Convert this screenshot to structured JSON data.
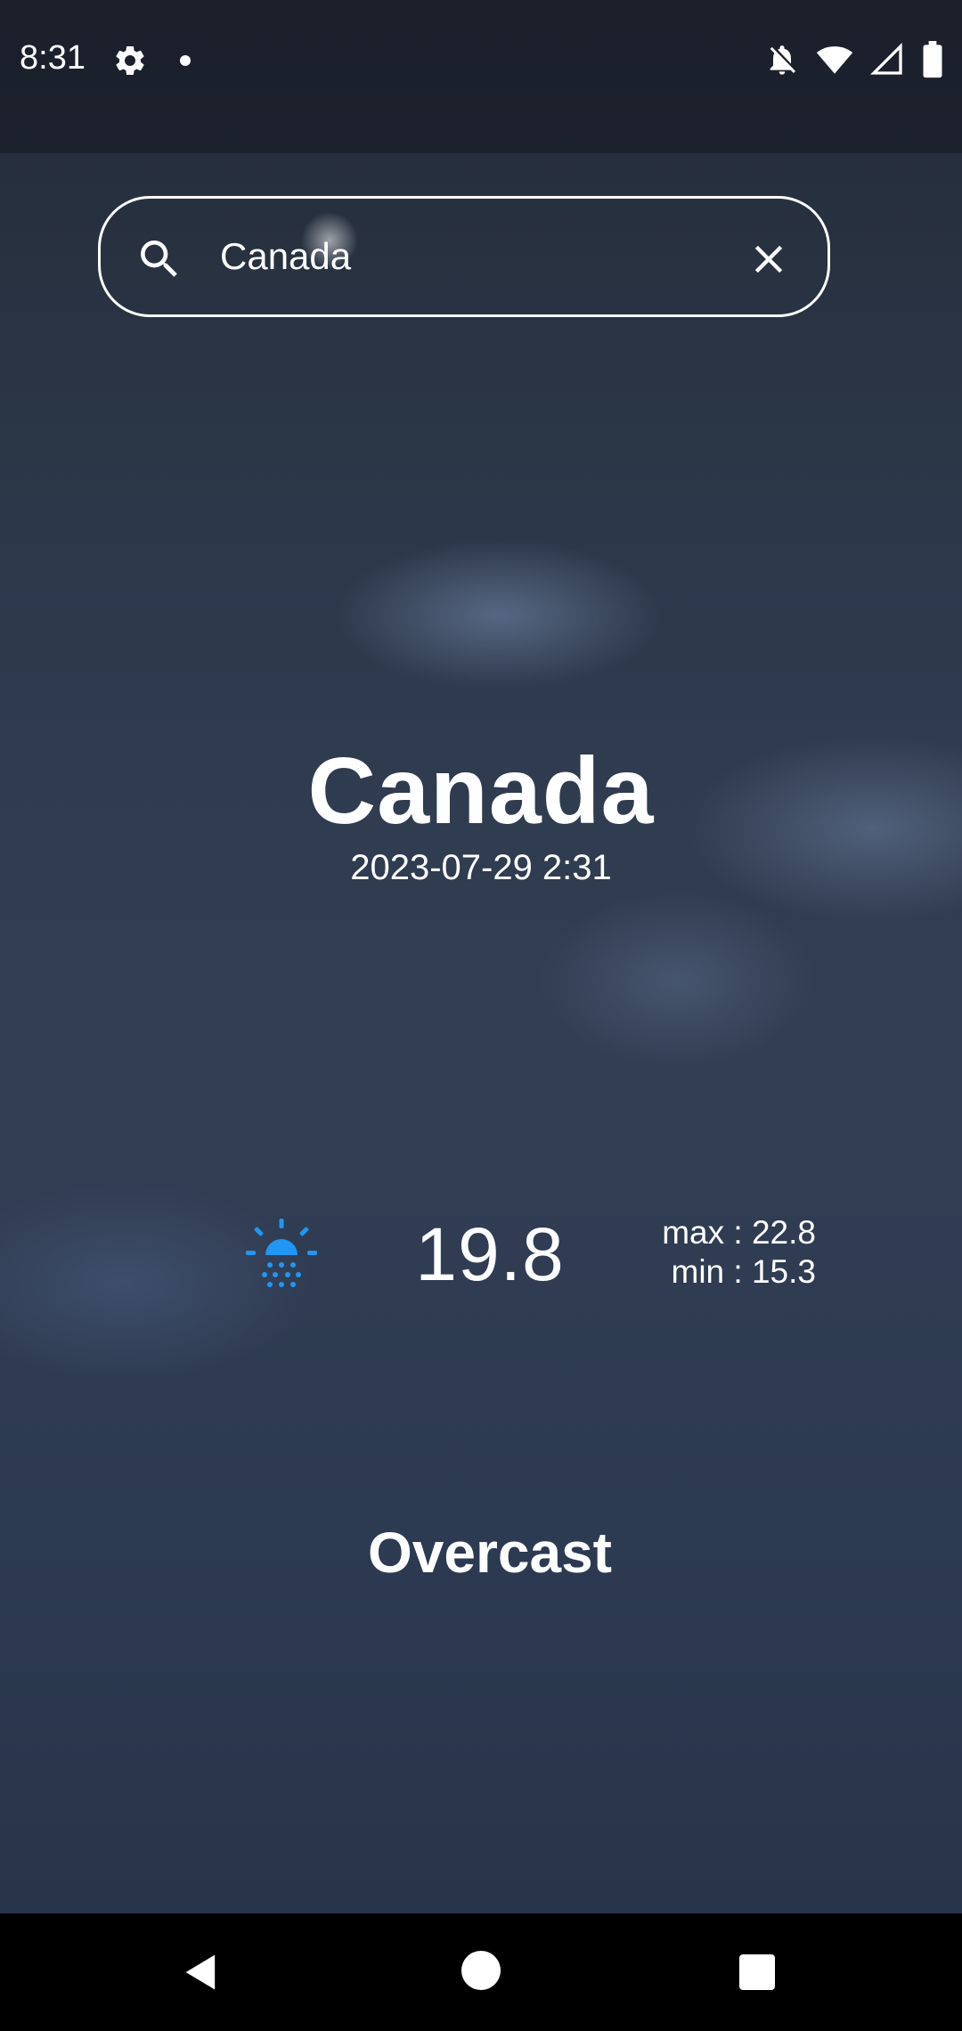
{
  "status_bar": {
    "time": "8:31",
    "icons": [
      "settings-gear-icon",
      "notification-dot-icon",
      "notifications-off-icon",
      "wifi-icon",
      "cellular-signal-icon",
      "battery-icon"
    ]
  },
  "search": {
    "value": "Canada",
    "icon": "search-icon",
    "clear_icon": "close-icon"
  },
  "weather": {
    "city": "Canada",
    "datetime": "2023-07-29 2:31",
    "condition_icon": "sunrise-drizzle-icon",
    "icon_color": "#2196F3",
    "temperature": "19.8",
    "max_label": "max : 22.8",
    "min_label": "min : 15.3",
    "condition": "Overcast"
  },
  "nav_bar": {
    "buttons": [
      "back-icon",
      "home-icon",
      "recents-icon"
    ]
  }
}
